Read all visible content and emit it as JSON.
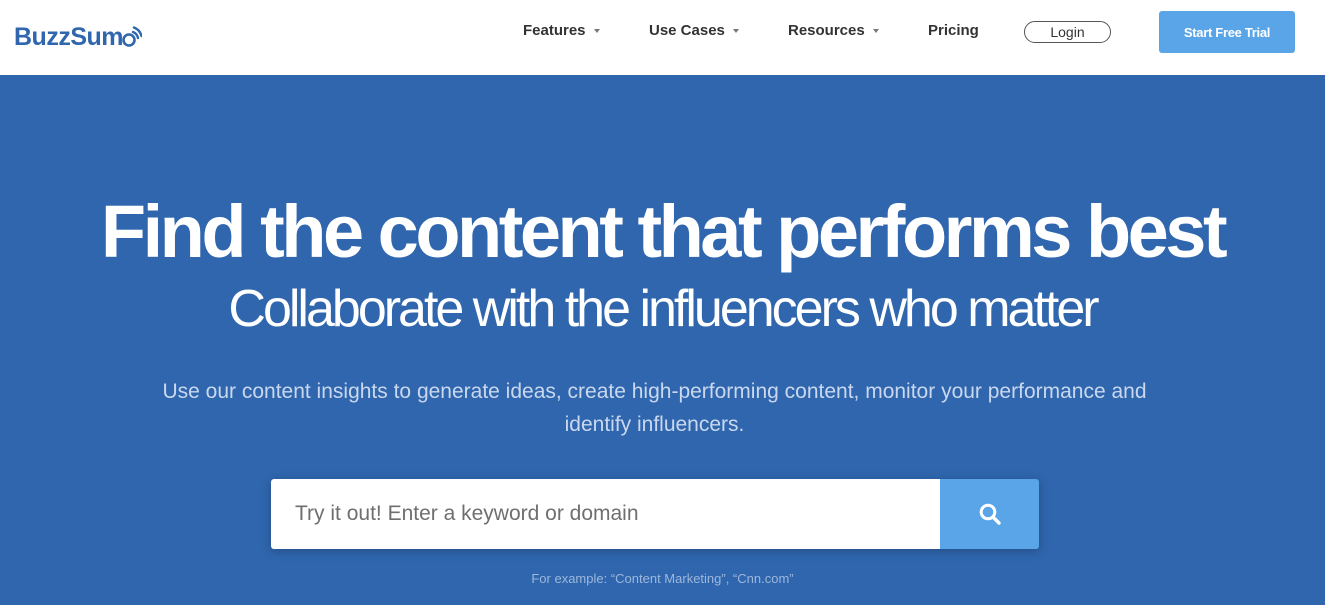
{
  "header": {
    "logo_text": "BuzzSum",
    "nav": [
      {
        "label": "Features",
        "has_dropdown": true
      },
      {
        "label": "Use Cases",
        "has_dropdown": true
      },
      {
        "label": "Resources",
        "has_dropdown": true
      },
      {
        "label": "Pricing",
        "has_dropdown": false
      }
    ],
    "login_label": "Login",
    "trial_label": "Start Free Trial"
  },
  "hero": {
    "headline": "Find the content that performs best",
    "subheadline": "Collaborate with the influencers who matter",
    "description": "Use our content insights to generate ideas, create high-performing content, monitor your performance and identify influencers.",
    "search": {
      "placeholder": "Try it out! Enter a keyword or domain",
      "value": ""
    },
    "example": "For example: “Content Marketing”, “Cnn.com”"
  },
  "colors": {
    "brand_blue": "#2f66ae",
    "accent_blue": "#5aa5e8",
    "header_bg": "#ffffff"
  },
  "icons": [
    "logo-signal-icon",
    "chevron-down-icon",
    "search-icon"
  ]
}
